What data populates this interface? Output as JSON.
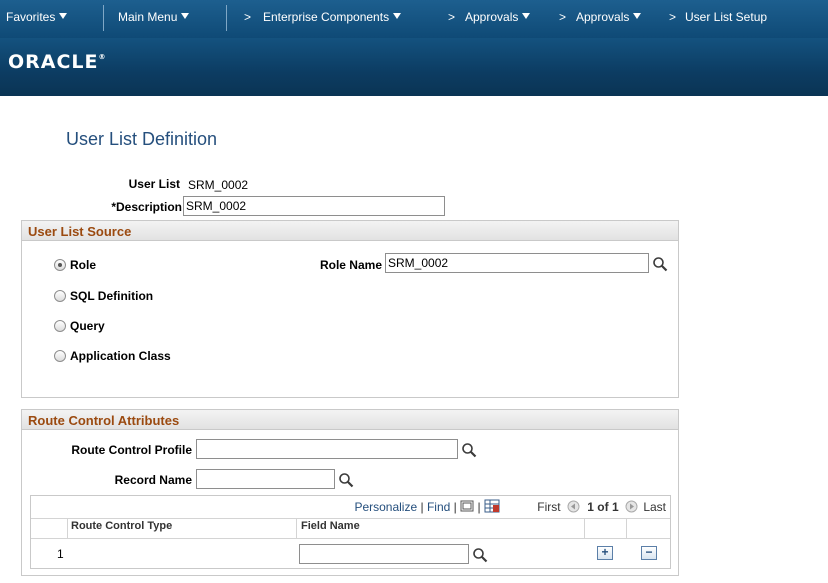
{
  "nav": {
    "favorites": "Favorites",
    "main_menu": "Main Menu",
    "crumbs": [
      "Enterprise Components",
      "Approvals",
      "Approvals",
      "User List Setup"
    ]
  },
  "brand": {
    "logo": "ORACLE"
  },
  "page": {
    "title": "User List Definition"
  },
  "user_list": {
    "label": "User List",
    "value": "SRM_0002"
  },
  "description": {
    "label": "*Description",
    "value": "SRM_0002"
  },
  "source": {
    "header": "User List Source",
    "options": [
      {
        "label": "Role",
        "selected": true
      },
      {
        "label": "SQL Definition",
        "selected": false
      },
      {
        "label": "Query",
        "selected": false
      },
      {
        "label": "Application Class",
        "selected": false
      }
    ],
    "role_name": {
      "label": "Role Name",
      "value": "SRM_0002"
    }
  },
  "route": {
    "header": "Route Control Attributes",
    "profile": {
      "label": "Route Control Profile",
      "value": ""
    },
    "record": {
      "label": "Record Name",
      "value": ""
    }
  },
  "grid": {
    "personalize": "Personalize",
    "find": "Find",
    "first": "First",
    "range": "1 of 1",
    "last": "Last",
    "col_type": "Route Control Type",
    "col_field": "Field Name",
    "rows": [
      {
        "num": "1",
        "type": "",
        "field": ""
      }
    ]
  },
  "colors": {
    "nav_bg": "#1d5f8f",
    "title": "#254f7d",
    "section_header": "#9b4a10"
  }
}
